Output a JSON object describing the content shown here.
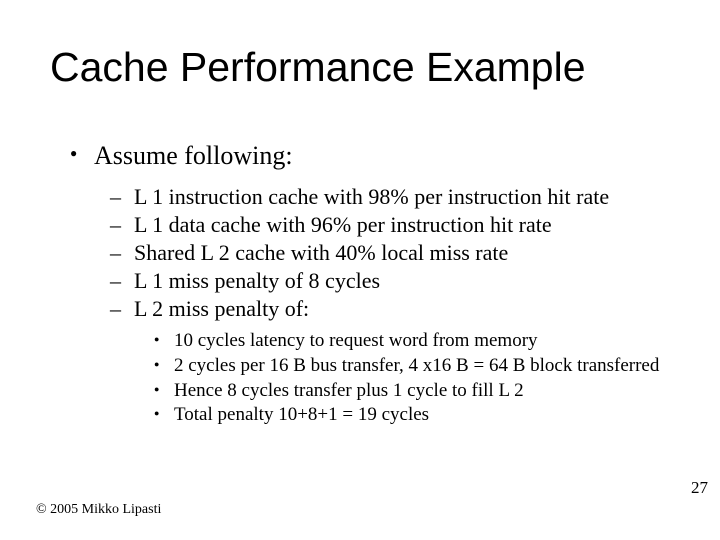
{
  "title": "Cache Performance Example",
  "assume_label": "Assume following:",
  "dashes": {
    "d0": "L 1 instruction cache with 98% per instruction hit rate",
    "d1": "L 1 data cache with 96% per instruction hit rate",
    "d2": "Shared L 2 cache with 40% local miss rate",
    "d3": "L 1 miss penalty of 8 cycles",
    "d4": "L 2 miss penalty of:"
  },
  "subs": {
    "s0": "10 cycles latency to request word from memory",
    "s1": "2 cycles per 16 B bus transfer, 4 x16 B = 64 B block transferred",
    "s2": "Hence 8 cycles transfer plus 1 cycle to fill L 2",
    "s3": "Total penalty 10+8+1 = 19 cycles"
  },
  "footer": "© 2005 Mikko Lipasti",
  "page_number": "27"
}
